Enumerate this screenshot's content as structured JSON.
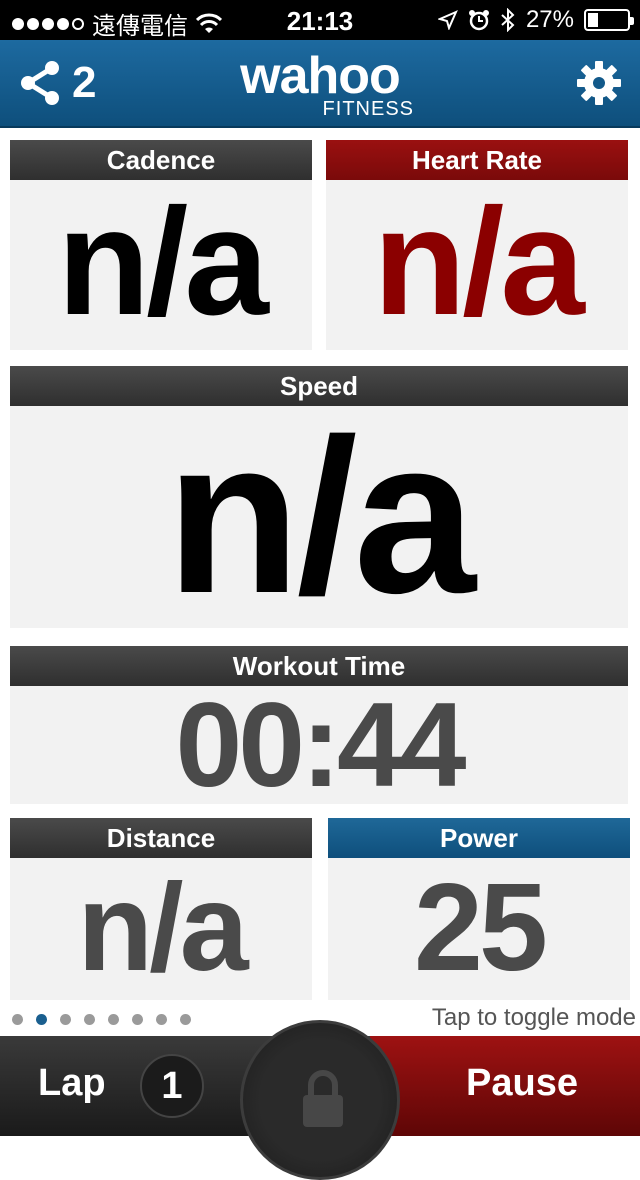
{
  "status": {
    "carrier": "遠傳電信",
    "time": "21:13",
    "battery": "27%"
  },
  "nav": {
    "share_count": "2",
    "brand": "wahoo",
    "brand_sub": "FITNESS"
  },
  "tiles": {
    "cadence": {
      "label": "Cadence",
      "value": "n/a"
    },
    "heart_rate": {
      "label": "Heart Rate",
      "value": "n/a"
    },
    "speed": {
      "label": "Speed",
      "value": "n/a"
    },
    "workout_time": {
      "label": "Workout Time",
      "value": "00:44"
    },
    "distance": {
      "label": "Distance",
      "value": "n/a"
    },
    "power": {
      "label": "Power",
      "value": "25"
    }
  },
  "pager": {
    "pages": 8,
    "active": 1
  },
  "hint": "Tap to toggle mode",
  "bottom": {
    "lap_label": "Lap",
    "lap_count": "1",
    "pause_label": "Pause"
  },
  "colors": {
    "nav_blue": "#12598a",
    "heart_red": "#8b0000",
    "dark_value": "#000000",
    "gray_value": "#4a4a4a"
  }
}
